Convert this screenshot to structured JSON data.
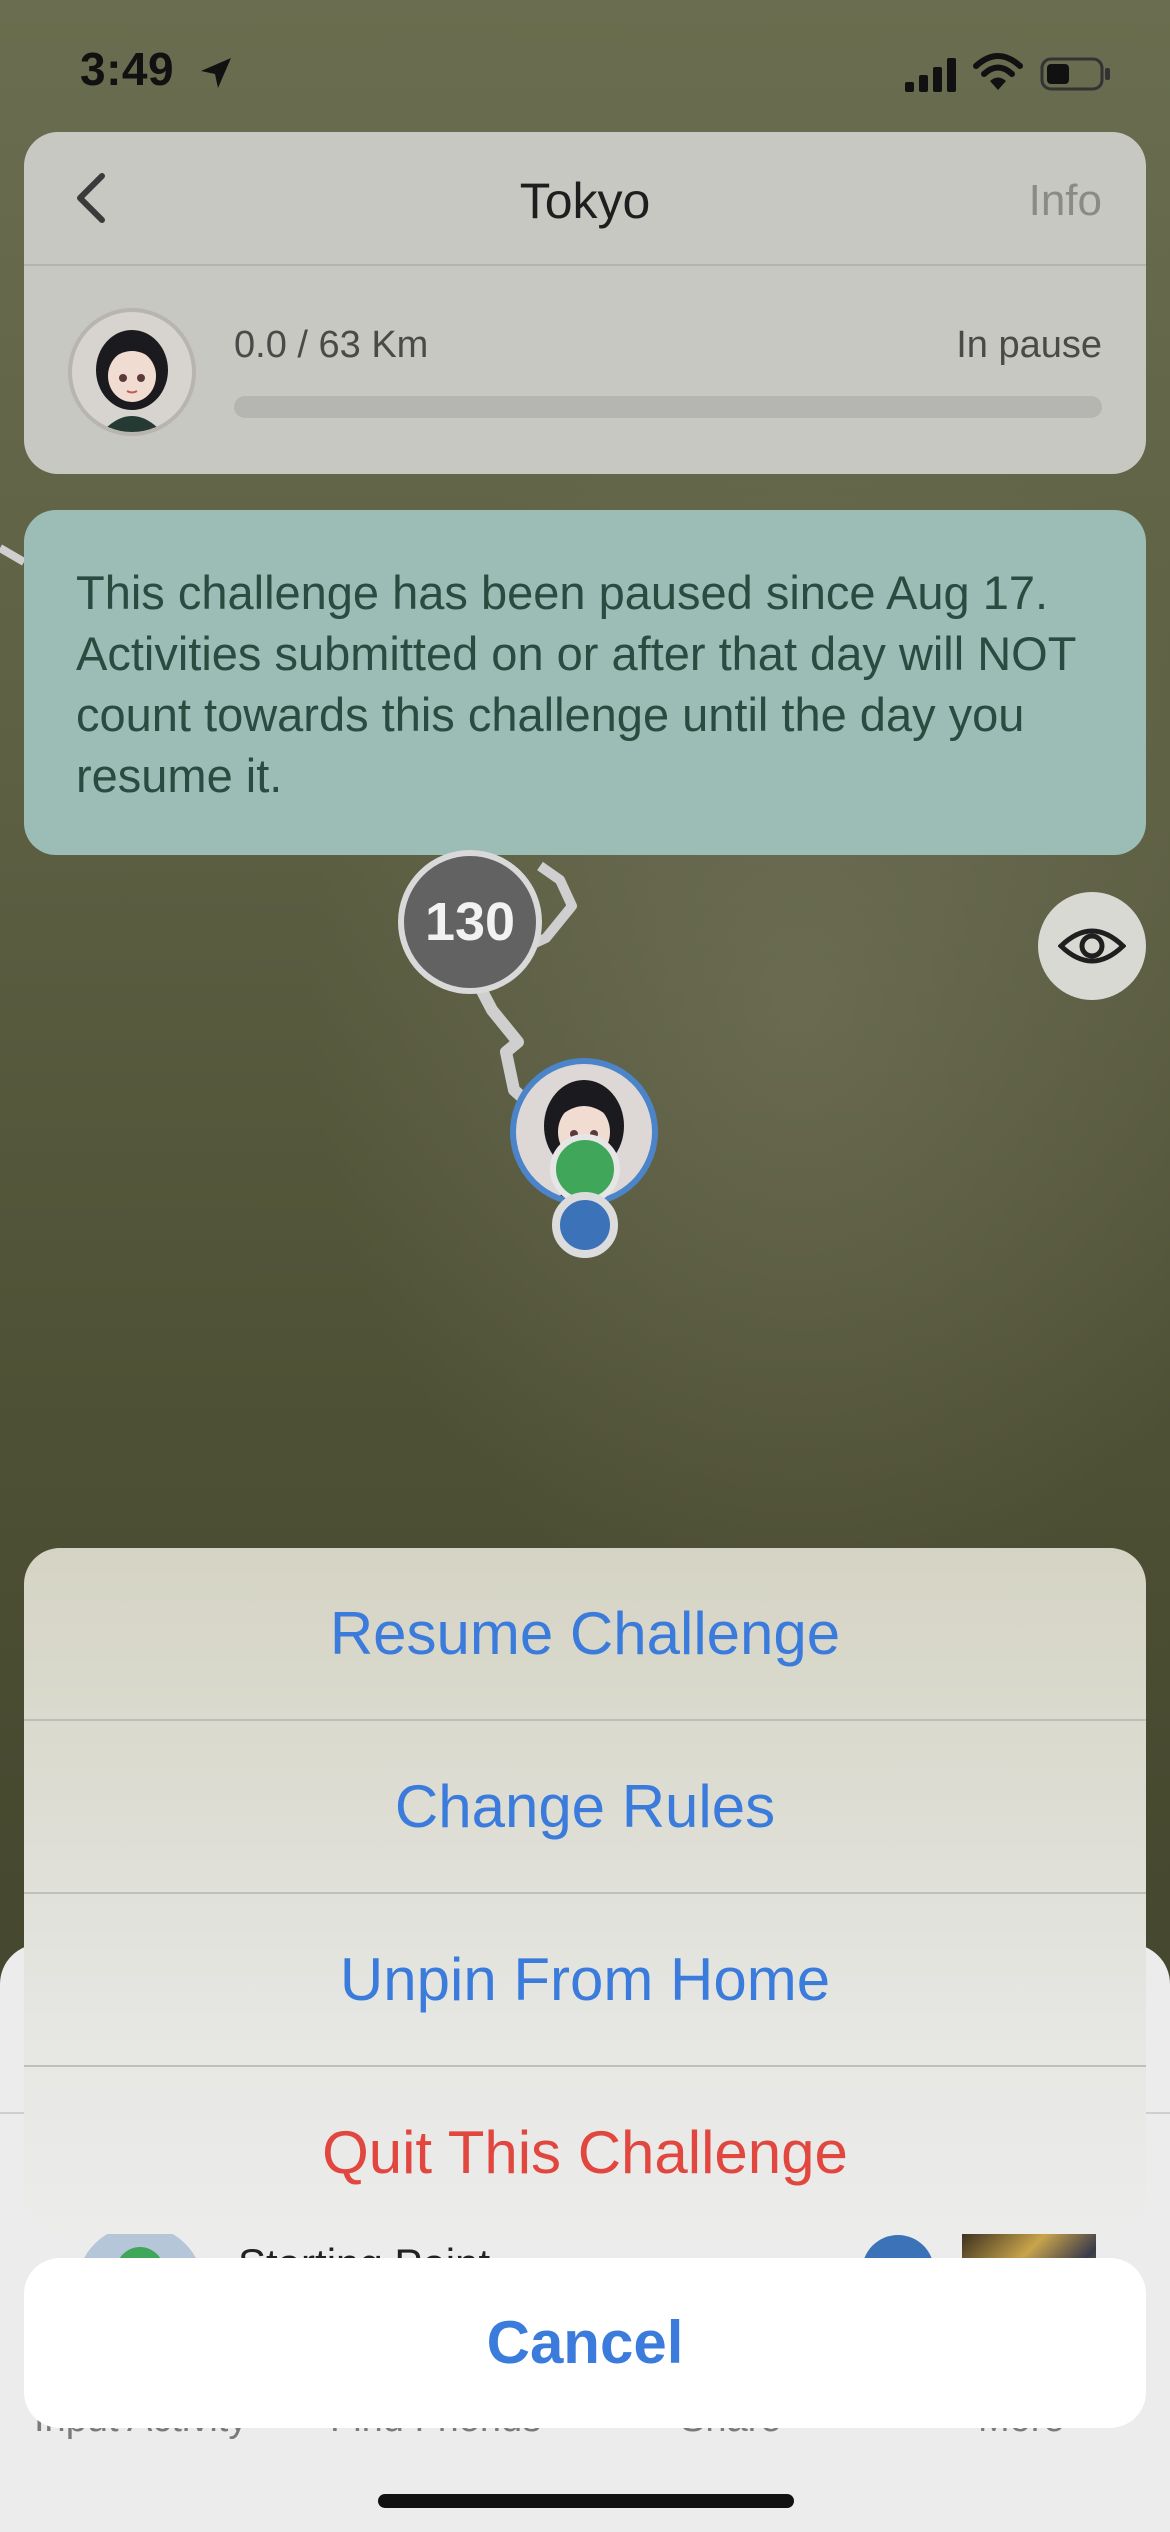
{
  "status_bar": {
    "time": "3:49"
  },
  "header": {
    "title": "Tokyo",
    "info_label": "Info",
    "progress_text": "0.0 / 63 Km",
    "status_text": "In pause",
    "progress_fraction": 0.0
  },
  "banner": {
    "message": "This challenge has been paused since Aug 17. Activities submitted on or after that day will NOT count towards this challenge until the day you resume it."
  },
  "map": {
    "marker_label": "130"
  },
  "bottom_panel": {
    "row_label": "Starting Point",
    "tabs": [
      "Input Activity",
      "Find Friends",
      "Share",
      "More"
    ]
  },
  "action_sheet": {
    "options": [
      {
        "label": "Resume Challenge",
        "style": "default"
      },
      {
        "label": "Change Rules",
        "style": "default"
      },
      {
        "label": "Unpin From Home",
        "style": "default"
      },
      {
        "label": "Quit This Challenge",
        "style": "destructive"
      }
    ],
    "cancel_label": "Cancel"
  },
  "colors": {
    "action_blue": "#3a7bdc",
    "destructive_red": "#e1473f",
    "banner_bg": "#9bbdb5",
    "banner_text": "#2b4b40"
  }
}
